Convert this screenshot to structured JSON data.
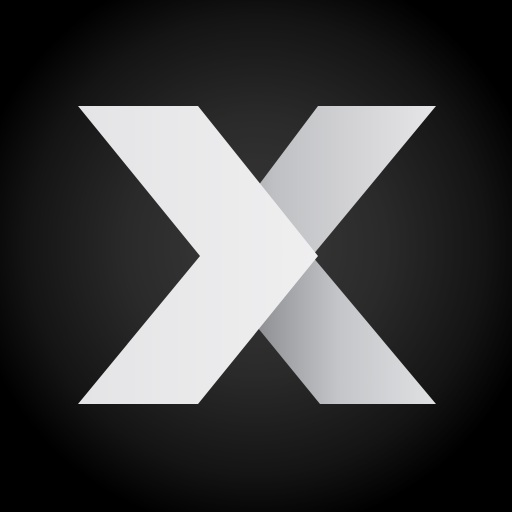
{
  "icon": {
    "name": "x-logo-icon",
    "colors": {
      "background_center": "#3a3a3a",
      "background_edge": "#000000",
      "chevron_light": "#eeeeef",
      "chevron_mid": "#d8d8da",
      "stroke_dark": "#8e8f93",
      "stroke_light": "#e2e3e5"
    }
  }
}
